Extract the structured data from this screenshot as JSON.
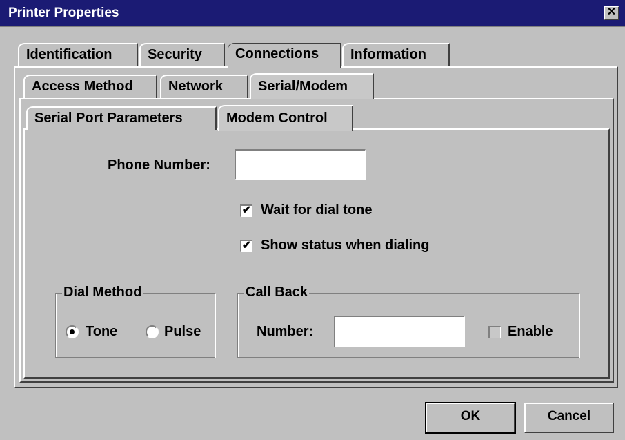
{
  "window": {
    "title": "Printer Properties",
    "close_glyph": "✕"
  },
  "tabs_row1": [
    {
      "label": "Identification"
    },
    {
      "label": "Security"
    },
    {
      "label": "Connections"
    },
    {
      "label": "Information"
    }
  ],
  "tabs_row2": [
    {
      "label": "Access Method"
    },
    {
      "label": "Network"
    },
    {
      "label": "Serial/Modem"
    }
  ],
  "tabs_row3": [
    {
      "label": "Serial Port Parameters"
    },
    {
      "label": "Modem Control"
    }
  ],
  "modem": {
    "phone_label": "Phone Number:",
    "phone_value": "",
    "wait_dial_tone": {
      "label": "Wait for dial tone",
      "checked": true
    },
    "show_status": {
      "label": "Show status when dialing",
      "checked": true
    }
  },
  "dial_method": {
    "title": "Dial Method",
    "options": [
      {
        "label": "Tone",
        "selected": true
      },
      {
        "label": "Pulse",
        "selected": false
      }
    ]
  },
  "call_back": {
    "title": "Call Back",
    "number_label": "Number:",
    "number_value": "",
    "enable_label": "Enable",
    "enable_checked": false
  },
  "buttons": {
    "ok": {
      "mnemonic": "O",
      "rest": "K"
    },
    "cancel": {
      "mnemonic": "C",
      "rest": "ancel"
    }
  },
  "check_glyph": "✔"
}
